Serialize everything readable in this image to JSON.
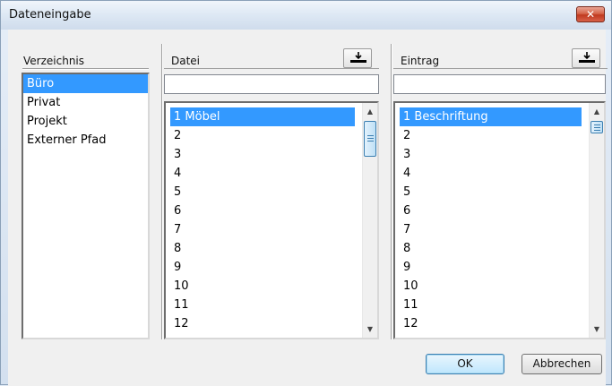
{
  "window": {
    "title": "Dateneingabe",
    "close_icon": "close-icon"
  },
  "verzeichnis": {
    "label": "Verzeichnis",
    "items": [
      "Büro",
      "Privat",
      "Projekt",
      "Externer Pfad"
    ],
    "selected": "Büro"
  },
  "datei": {
    "label": "Datei",
    "load_icon": "download-icon",
    "filter_value": "",
    "items": [
      "1 Möbel",
      "2",
      "3",
      "4",
      "5",
      "6",
      "7",
      "8",
      "9",
      "10",
      "11",
      "12"
    ],
    "selected": "1 Möbel"
  },
  "eintrag": {
    "label": "Eintrag",
    "load_icon": "download-icon",
    "filter_value": "",
    "items": [
      "1 Beschriftung",
      "2",
      "3",
      "4",
      "5",
      "6",
      "7",
      "8",
      "9",
      "10",
      "11",
      "12"
    ],
    "selected": "1 Beschriftung"
  },
  "buttons": {
    "ok": "OK",
    "cancel": "Abbrechen"
  },
  "colors": {
    "selection": "#3399ff",
    "scroll_thumb": "#bfe0f5"
  }
}
